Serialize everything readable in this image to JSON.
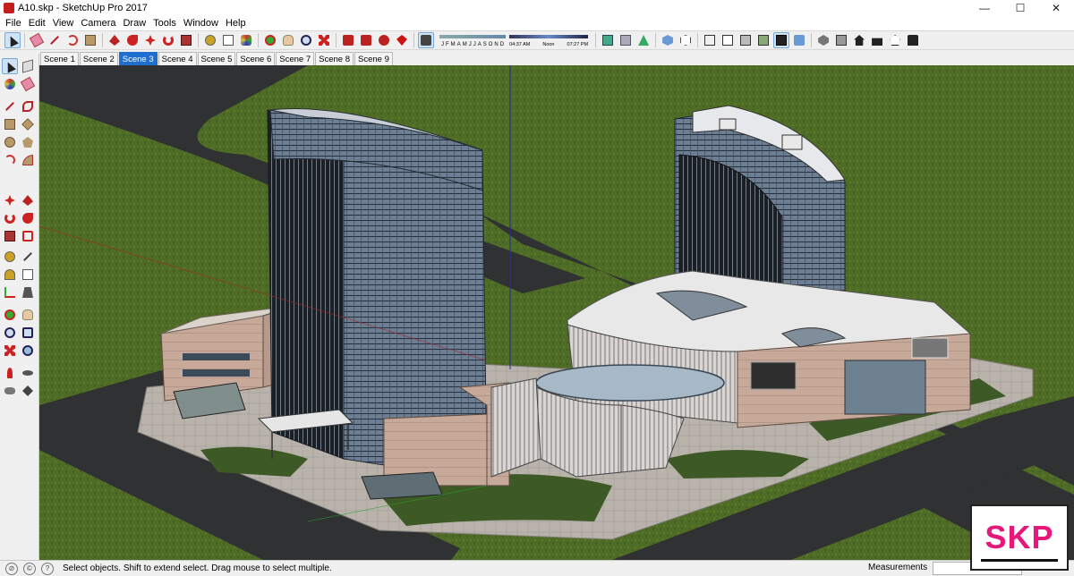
{
  "window": {
    "title": "A10.skp - SketchUp Pro 2017",
    "minimize": "—",
    "maximize": "☐",
    "close": "✕"
  },
  "menu": [
    "File",
    "Edit",
    "View",
    "Camera",
    "Draw",
    "Tools",
    "Window",
    "Help"
  ],
  "shadow": {
    "months": [
      "J",
      "F",
      "M",
      "A",
      "M",
      "J",
      "J",
      "A",
      "S",
      "O",
      "N",
      "D"
    ],
    "time_start": "04:37 AM",
    "time_mid": "Noon",
    "time_end": "07:27 PM"
  },
  "scenes": [
    "Scene 1",
    "Scene 2",
    "Scene 3",
    "Scene 4",
    "Scene 5",
    "Scene 6",
    "Scene 7",
    "Scene 8",
    "Scene 9"
  ],
  "active_scene": "Scene 3",
  "status": {
    "hint": "Select objects. Shift to extend select. Drag mouse to select multiple.",
    "measurements_label": "Measurements",
    "measurements_value": ""
  },
  "badge": "SKP",
  "colors": {
    "grass": "#4c6b24",
    "road": "#2f3133",
    "selection_blue": "#1f6fd1",
    "badge_pink": "#e6197a"
  },
  "toolbar_icons": [
    "select-icon",
    "eraser-icon",
    "line-icon",
    "shape-icon",
    "paint-icon",
    "push-pull-icon",
    "follow-me-icon",
    "move-icon",
    "rotate-icon",
    "offset-icon",
    "tape-icon",
    "text-icon",
    "paint-bucket-icon",
    "orbit-icon",
    "pan-icon",
    "zoom-icon",
    "zoom-extents-icon",
    "warehouse-icon",
    "extension-icon",
    "layout-icon",
    "ruby-icon",
    "shadows-toggle-icon",
    "styles-icon",
    "views-icon"
  ]
}
